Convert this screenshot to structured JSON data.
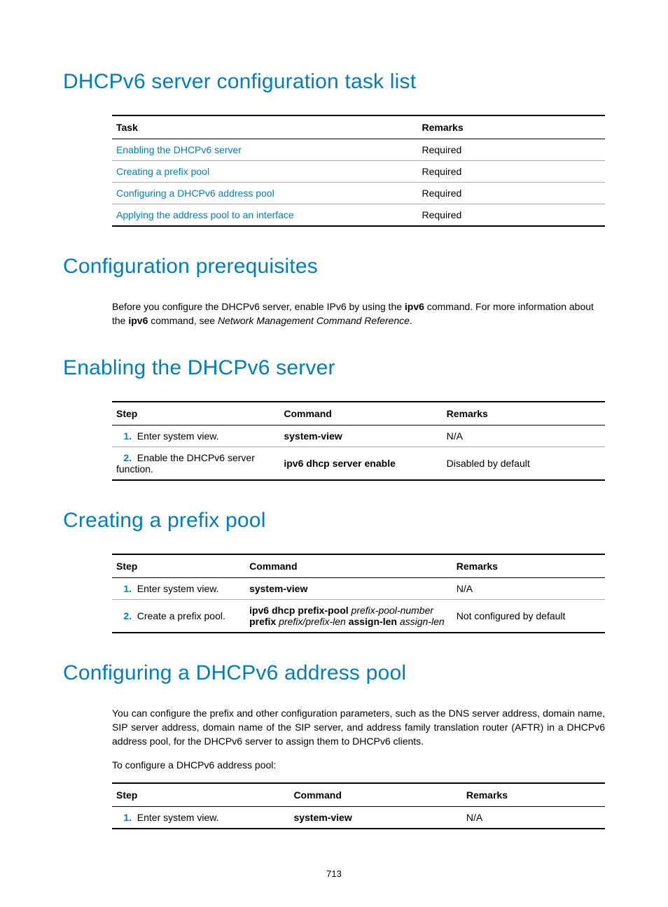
{
  "sections": {
    "task_list": {
      "heading": "DHCPv6 server configuration task list",
      "headers": {
        "task": "Task",
        "remarks": "Remarks"
      },
      "rows": [
        {
          "task": "Enabling the DHCPv6 server",
          "remarks": "Required"
        },
        {
          "task": "Creating a prefix pool",
          "remarks": "Required"
        },
        {
          "task": "Configuring a DHCPv6 address pool",
          "remarks": "Required"
        },
        {
          "task": "Applying the address pool to an interface",
          "remarks": "Required"
        }
      ]
    },
    "prereq": {
      "heading": "Configuration prerequisites",
      "text_pre": "Before you configure the DHCPv6 server, enable IPv6 by using the ",
      "text_cmd1": "ipv6",
      "text_mid": " command. For more information about the ",
      "text_cmd2": "ipv6",
      "text_mid2": " command, see ",
      "text_ref": "Network Management Command Reference",
      "text_post": "."
    },
    "enable": {
      "heading": "Enabling the DHCPv6 server",
      "headers": {
        "step": "Step",
        "command": "Command",
        "remarks": "Remarks"
      },
      "rows": [
        {
          "num": "1.",
          "step": "Enter system view.",
          "command": "system-view",
          "remarks": "N/A"
        },
        {
          "num": "2.",
          "step": "Enable the DHCPv6 server function.",
          "command": "ipv6 dhcp server enable",
          "remarks": "Disabled by default"
        }
      ]
    },
    "prefix_pool": {
      "heading": "Creating a prefix pool",
      "headers": {
        "step": "Step",
        "command": "Command",
        "remarks": "Remarks"
      },
      "rows": [
        {
          "num": "1.",
          "step": "Enter system view.",
          "cmd_bold1": "system-view",
          "remarks": "N/A"
        },
        {
          "num": "2.",
          "step": "Create a prefix pool.",
          "cmd_bold1": "ipv6 dhcp prefix-pool",
          "cmd_it1": " prefix-pool-number ",
          "cmd_bold2": "prefix",
          "cmd_it2": " prefix/prefix-len ",
          "cmd_bold3": "assign-len",
          "cmd_it3": " assign-len",
          "remarks": "Not configured by default"
        }
      ]
    },
    "addr_pool": {
      "heading": "Configuring a DHCPv6 address pool",
      "para": "You can configure the prefix and other configuration parameters, such as the DNS server address, domain name, SIP server address, domain name of the SIP server, and address family translation router (AFTR) in a DHCPv6 address pool, for the DHCPv6 server to assign them to DHCPv6 clients.",
      "intro": "To configure a DHCPv6 address pool:",
      "headers": {
        "step": "Step",
        "command": "Command",
        "remarks": "Remarks"
      },
      "rows": [
        {
          "num": "1.",
          "step": "Enter system view.",
          "command": "system-view",
          "remarks": "N/A"
        }
      ]
    }
  },
  "page_number": "713"
}
